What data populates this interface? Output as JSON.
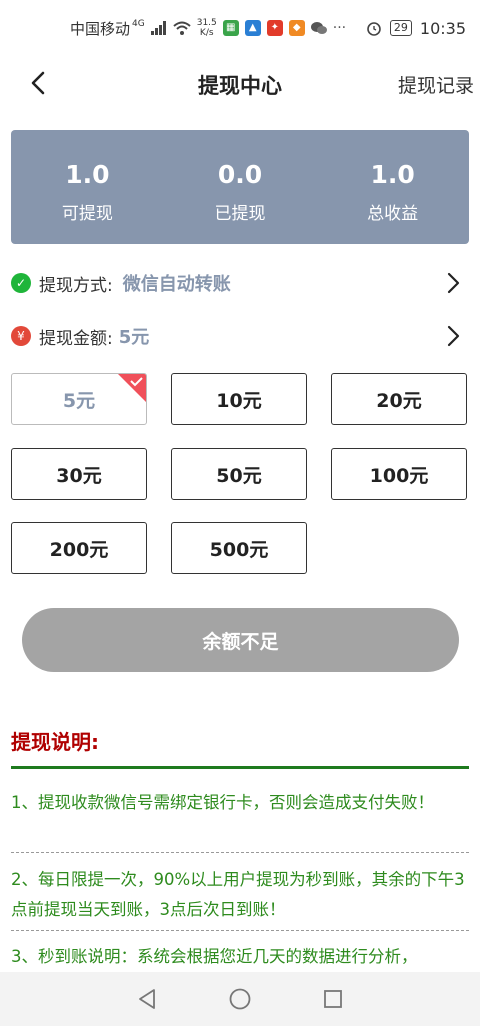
{
  "status_bar": {
    "carrier": "中国移动",
    "network_tag": "4G",
    "speed_value": "31.5",
    "speed_unit": "K/s",
    "battery": "29",
    "time": "10:35"
  },
  "header": {
    "title": "提现中心",
    "record_link": "提现记录"
  },
  "summary": [
    {
      "value": "1.0",
      "label": "可提现"
    },
    {
      "value": "0.0",
      "label": "已提现"
    },
    {
      "value": "1.0",
      "label": "总收益"
    }
  ],
  "method": {
    "label": "提现方式:",
    "value": "微信自动转账"
  },
  "amount": {
    "label": "提现金额:",
    "value": "5元"
  },
  "amount_options": [
    "5元",
    "10元",
    "20元",
    "30元",
    "50元",
    "100元",
    "200元",
    "500元"
  ],
  "selected_option": "5元",
  "submit_button": "余额不足",
  "notes": {
    "title": "提现说明:",
    "items": [
      "1、提现收款微信号需绑定银行卡，否则会造成支付失败！",
      "2、每日限提一次，90%以上用户提现为秒到账，其余的下午3点前提现当天到账，3点后次日到账！",
      "3、秒到账说明：系统会根据您近几天的数据进行分析，"
    ]
  },
  "colors": {
    "accent": "#8796ad",
    "notes_title": "#b00000",
    "notes_text": "#2e8b1e",
    "button_disabled": "#a4a4a4"
  }
}
